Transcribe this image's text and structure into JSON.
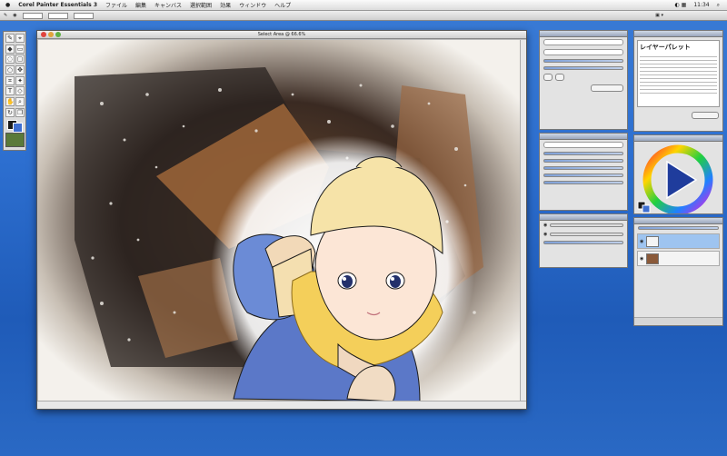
{
  "menubar": {
    "app_name": "Corel Painter Essentials 3",
    "items": [
      "ファイル",
      "編集",
      "キャンバス",
      "選択範囲",
      "効果",
      "ウィンドウ",
      "ヘルプ"
    ],
    "clock": "11:34"
  },
  "document": {
    "title": "Select Area @ 66.6%"
  },
  "panels": {
    "help": {
      "heading": "レイヤーパレット"
    }
  },
  "colors": {
    "desktop": "#2d6fd0",
    "panel_bg": "#e3e3e3",
    "foreground_color": "#1a1a1a",
    "background_color": "#3f6fd0"
  },
  "icons": {
    "apple": "apple-icon",
    "play": "play-triangle-icon"
  }
}
